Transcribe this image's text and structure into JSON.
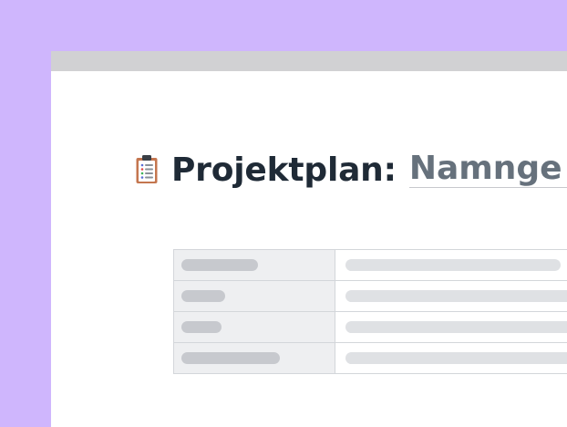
{
  "document": {
    "icon": "clipboard-icon",
    "title_prefix": "Projektplan:",
    "title_value": "Namnge d"
  },
  "colors": {
    "background": "#cfb6fd",
    "topbar": "#d1d1d3",
    "title_text": "#1f2a36",
    "title_input_text": "#66717c",
    "table_key_bg": "#eeeff1",
    "skeleton_key": "#c7c9ce",
    "skeleton_value": "#dfe1e4"
  },
  "properties_table": {
    "row_count": 4
  }
}
